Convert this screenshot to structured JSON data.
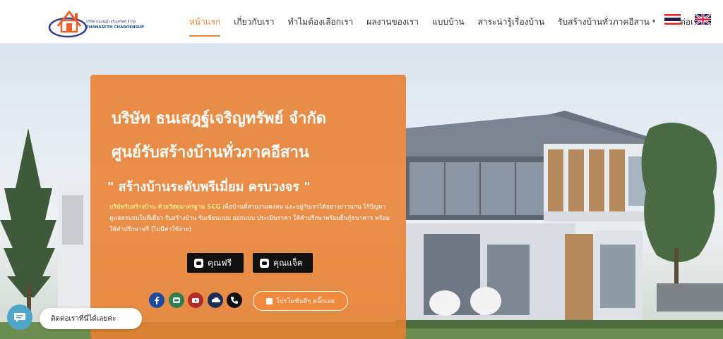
{
  "logo": {
    "line1": "บริษัท ธนเสฎฐ์ เจริญทรัพย์ จำกัด",
    "line2": "THANASETH CHAROENSUP",
    "line3": "www"
  },
  "nav": {
    "items": [
      {
        "label": "หน้าแรก",
        "active": true
      },
      {
        "label": "เกี่ยวกับเรา"
      },
      {
        "label": "ทำไมต้องเลือกเรา"
      },
      {
        "label": "ผลงานของเรา"
      },
      {
        "label": "แบบบ้าน"
      },
      {
        "label": "สาระน่ารู้เรื่องบ้าน"
      },
      {
        "label": "รับสร้างบ้านทั่วภาคอีสาน",
        "has_dropdown": true
      },
      {
        "label": "ติดต่อเรา"
      }
    ],
    "languages": [
      "thai-flag-icon",
      "uk-flag-icon"
    ]
  },
  "hero": {
    "title1": "บริษัท ธนเสฎฐ์เจริญทรัพย์ จำกัด",
    "title2": "ศูนย์รับสร้างบ้านทั่วภาคอีสาน",
    "slogan": "\" สร้างบ้านระดับพรีเมี่ยม ครบวงจร \"",
    "body_highlight": "บริษัทรับสร้างบ้าน ด้วยวัสดุมาตรฐาน SCG",
    "body_text": " เพื่อบ้านที่สวยงามคงทน และอยู่กับเราได้อย่างยาวนาน ไร้ปัญหาดูแลครบจบในที่เดียว รับสร้างบ้าน รับเขียนแบบ ออกแบบ ประเมินราคา ให้คำปรึกษาพร้อมยื่นกู้ธนาคาร พร้อมให้คำปรึกษาฟรี (ไม่มีค่าใช้จ่าย)",
    "buttons": {
      "free": "คุณฟรี",
      "jack": "คุณแจ็ค"
    },
    "social_icons": [
      "facebook-icon",
      "line-icon",
      "youtube-icon",
      "soundcloud-icon",
      "phone-icon"
    ],
    "promo": "โปรโมชั่นดีๆ คลิ๊กเลย"
  },
  "chat": {
    "bubble": "ติดต่อเราที่นี่ได้เลยค่ะ"
  },
  "colors": {
    "accent": "#e8873a",
    "panel": "#e88030",
    "chat": "#4fa6c9"
  }
}
